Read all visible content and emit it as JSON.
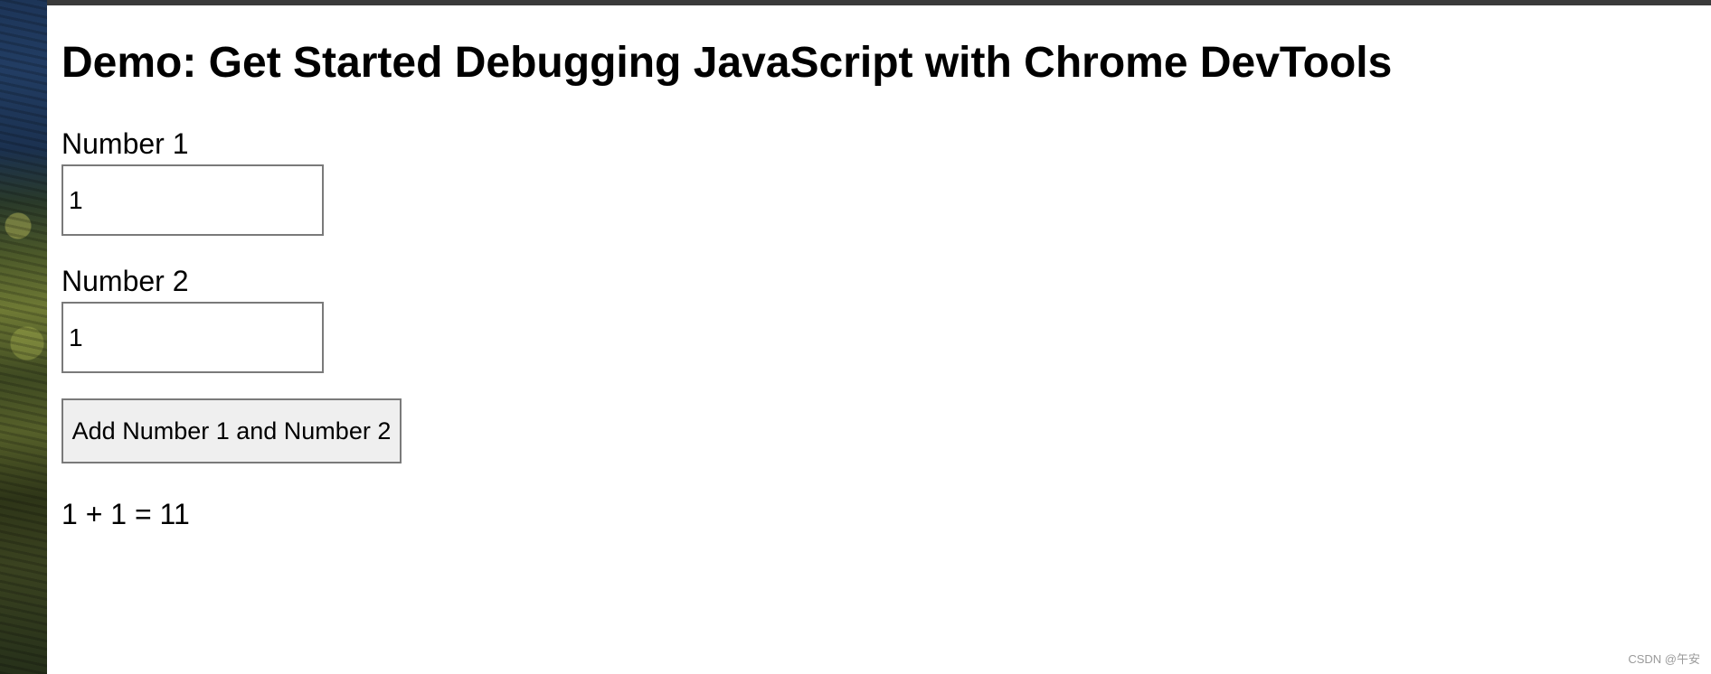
{
  "page": {
    "title": "Demo: Get Started Debugging JavaScript with Chrome DevTools"
  },
  "form": {
    "number1_label": "Number 1",
    "number1_value": "1",
    "number2_label": "Number 2",
    "number2_value": "1",
    "add_button_label": "Add Number 1 and Number 2"
  },
  "result": {
    "text": "1 + 1 = 11"
  },
  "watermark": {
    "text": "CSDN @午安"
  }
}
